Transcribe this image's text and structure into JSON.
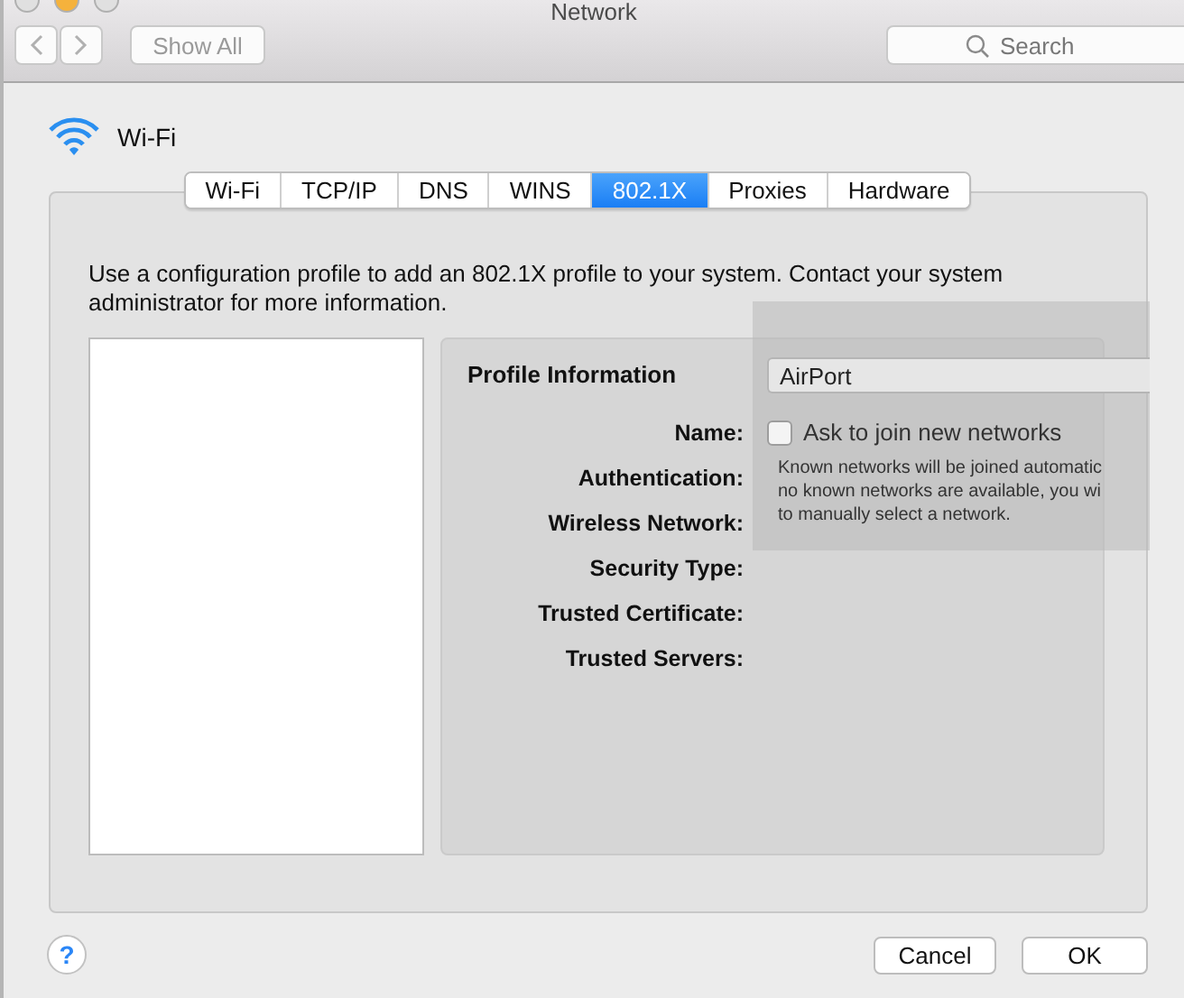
{
  "window": {
    "title": "Network"
  },
  "toolbar": {
    "show_all": {
      "label": "Show All",
      "disabled": true
    },
    "search": {
      "placeholder": "Search"
    }
  },
  "service": {
    "name": "Wi-Fi"
  },
  "tabs": [
    {
      "label": "Wi-Fi",
      "selected": false
    },
    {
      "label": "TCP/IP",
      "selected": false
    },
    {
      "label": "DNS",
      "selected": false
    },
    {
      "label": "WINS",
      "selected": false
    },
    {
      "label": "802.1X",
      "selected": true
    },
    {
      "label": "Proxies",
      "selected": false
    },
    {
      "label": "Hardware",
      "selected": false
    }
  ],
  "description": "Use a configuration profile to add an 802.1X profile to your system. Contact your system administrator for more information.",
  "profile_info": {
    "title": "Profile Information",
    "fields": [
      {
        "label": "Name:"
      },
      {
        "label": "Authentication:"
      },
      {
        "label": "Wireless Network:"
      },
      {
        "label": "Security Type:"
      },
      {
        "label": "Trusted Certificate:"
      },
      {
        "label": "Trusted Servers:"
      }
    ]
  },
  "overlay": {
    "network_name": "AirPort",
    "ask_to_join": {
      "label": "Ask to join new networks",
      "checked": false
    },
    "note_lines": [
      "Known networks will be joined automatic",
      "no known networks are available, you wi",
      "to manually select a network."
    ]
  },
  "help": "?",
  "buttons": [
    {
      "label": "Cancel"
    },
    {
      "label": "OK"
    }
  ]
}
